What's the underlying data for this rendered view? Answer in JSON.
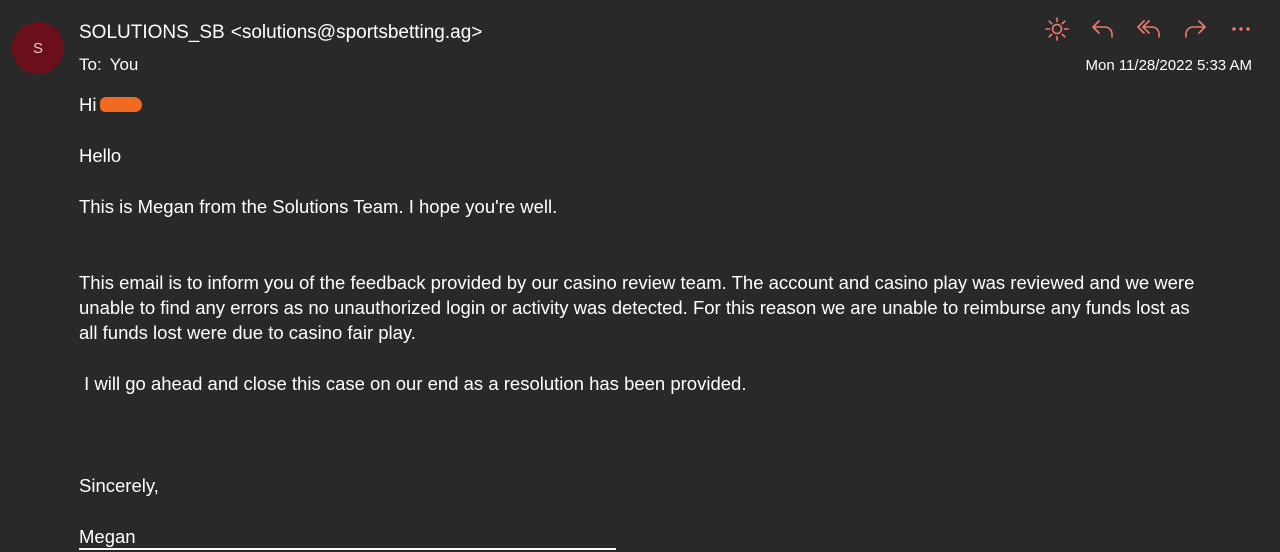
{
  "colors": {
    "background": "#292929",
    "avatar_bg": "#6b0f1a",
    "icon_accent": "#f07b6e",
    "redaction": "#f26a21"
  },
  "header": {
    "avatar_initial": "S",
    "sender_name": "SOLUTIONS_SB",
    "sender_email": "<solutions@sportsbetting.ag>",
    "to_label": "To:",
    "to_value": "You",
    "date": "Mon 11/28/2022 5:33 AM"
  },
  "toolbar": {
    "icons": [
      "sun-icon",
      "reply-icon",
      "reply-all-icon",
      "forward-icon",
      "more-icon"
    ]
  },
  "message": {
    "greeting": "Hi",
    "hello": "Hello",
    "intro": "This is Megan from the Solutions Team. I hope you're well.",
    "para1_line1": "This email is to inform you of the feedback provided by our casino review team. The account and casino play was reviewed and we were",
    "para1_line2": "unable to find any errors as no unauthorized login or activity was detected. For this reason we are unable to reimburse any funds lost as",
    "para1_line3": "all funds lost were due to casino fair play.",
    "para2": " I will go ahead and close this case on our end as a resolution has been provided.",
    "signoff": "Sincerely,",
    "signature": "Megan"
  }
}
